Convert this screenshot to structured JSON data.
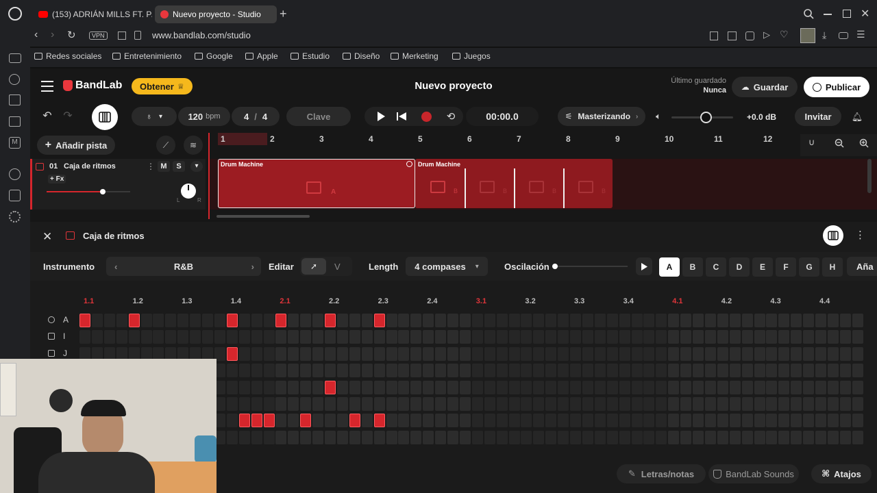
{
  "browser": {
    "tabs": [
      {
        "label": "(153) ADRIÁN MILLS FT. P/",
        "active": false
      },
      {
        "label": "Nuevo proyecto - Studio",
        "active": true
      }
    ],
    "url": "www.bandlab.com/studio",
    "vpn_label": "VPN",
    "bookmarks": [
      "Redes sociales",
      "Entretenimiento",
      "Google",
      "Apple",
      "Estudio",
      "Diseño",
      "Merketing",
      "Juegos"
    ]
  },
  "header": {
    "brand": "BandLab",
    "obtain_label": "Obtener",
    "project_title": "Nuevo proyecto",
    "last_saved_label": "Último guardado",
    "last_saved_value": "Nunca",
    "save_label": "Guardar",
    "publish_label": "Publicar"
  },
  "transport": {
    "tempo": "120",
    "tempo_unit": "bpm",
    "time_sig_top": "4",
    "time_sig_bottom": "4",
    "key_label": "Clave",
    "time": "00:00.0",
    "mastering_label": "Masterizando",
    "volume_db": "+0.0 dB",
    "invite_label": "Invitar",
    "volume_level": 0.55
  },
  "tracks_panel": {
    "add_track_label": "Añadir pista",
    "ruler": [
      "1",
      "2",
      "3",
      "4",
      "5",
      "6",
      "7",
      "8",
      "9",
      "10",
      "11",
      "12"
    ],
    "track": {
      "number": "01",
      "name": "Caja de ritmos",
      "mute": "M",
      "solo": "S",
      "fx_label": "+ Fx",
      "pan_left": "L",
      "pan_right": "R",
      "volume_level": 0.67
    },
    "regions": [
      {
        "title": "Drum Machine",
        "pattern": "A"
      },
      {
        "title": "Drum Machine",
        "patterns": [
          "B",
          "B",
          "B",
          "B"
        ]
      }
    ]
  },
  "drum_panel": {
    "title": "Caja de ritmos",
    "instrument_label": "Instrumento",
    "instrument_value": "R&B",
    "edit_label": "Editar",
    "velocity_label": "V",
    "length_label": "Length",
    "length_value": "4 compases",
    "swing_label": "Oscilación",
    "patterns": [
      "A",
      "B",
      "C",
      "D",
      "E",
      "F",
      "G",
      "H"
    ],
    "active_pattern": "A",
    "add_label": "Aña",
    "beats": [
      "1.1",
      "1.2",
      "1.3",
      "1.4",
      "2.1",
      "2.2",
      "2.3",
      "2.4",
      "3.1",
      "3.2",
      "3.3",
      "3.4",
      "4.1",
      "4.2",
      "4.3",
      "4.4"
    ],
    "rows": [
      {
        "label": "A",
        "icon": "kick-drum-icon"
      },
      {
        "label": "I",
        "icon": "snare-drum-icon"
      },
      {
        "label": "J",
        "icon": "sparkle-icon"
      },
      {
        "label": "",
        "icon": ""
      },
      {
        "label": "",
        "icon": ""
      },
      {
        "label": "",
        "icon": ""
      },
      {
        "label": "",
        "icon": ""
      },
      {
        "label": "",
        "icon": ""
      }
    ],
    "active_steps": [
      [
        0,
        4,
        12,
        16,
        20,
        24
      ],
      [],
      [
        12
      ],
      [],
      [
        20
      ],
      [],
      [
        13,
        14,
        15,
        18,
        22,
        24
      ],
      []
    ]
  },
  "footer": {
    "lyrics_label": "Letras/notas",
    "sounds_label": "BandLab Sounds",
    "shortcuts_label": "Atajos"
  },
  "colors": {
    "accent": "#d6262c",
    "brand_yellow": "#f5b81c",
    "region": "#8e1a1f"
  }
}
